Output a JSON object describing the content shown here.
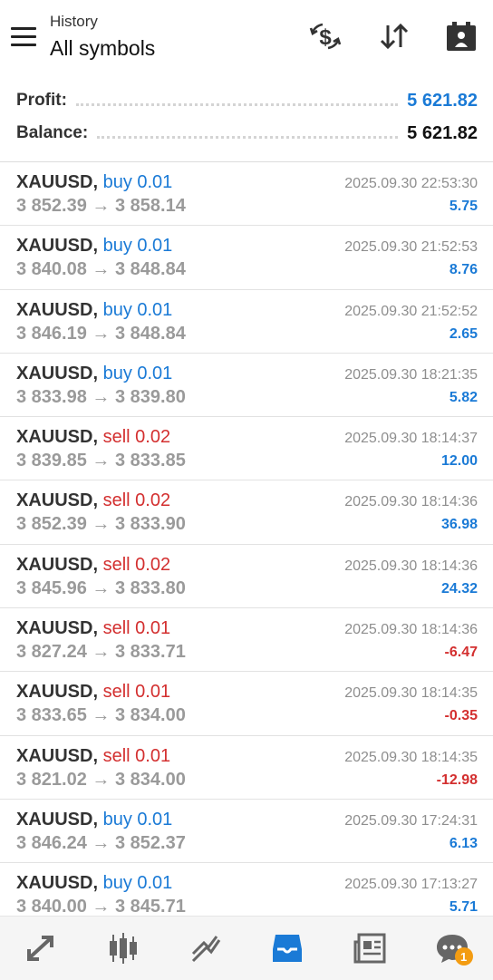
{
  "header": {
    "subtitle": "History",
    "title": "All symbols",
    "icons": [
      "menu-icon",
      "deposit-withdraw-icon",
      "sort-icon",
      "calendar-icon"
    ]
  },
  "summary": {
    "profit_label": "Profit:",
    "profit_value": "5 621.82",
    "balance_label": "Balance:",
    "balance_value": "5 621.82"
  },
  "trades": [
    {
      "symbol": "XAUUSD,",
      "side": "buy 0.01",
      "prices": "3 852.39 → 3 858.14",
      "time": "2025.09.30 22:53:30",
      "profit": "5.75"
    },
    {
      "symbol": "XAUUSD,",
      "side": "buy 0.01",
      "prices": "3 840.08 → 3 848.84",
      "time": "2025.09.30 21:52:53",
      "profit": "8.76"
    },
    {
      "symbol": "XAUUSD,",
      "side": "buy 0.01",
      "prices": "3 846.19 → 3 848.84",
      "time": "2025.09.30 21:52:52",
      "profit": "2.65"
    },
    {
      "symbol": "XAUUSD,",
      "side": "buy 0.01",
      "prices": "3 833.98 → 3 839.80",
      "time": "2025.09.30 18:21:35",
      "profit": "5.82"
    },
    {
      "symbol": "XAUUSD,",
      "side": "sell 0.02",
      "prices": "3 839.85 → 3 833.85",
      "time": "2025.09.30 18:14:37",
      "profit": "12.00"
    },
    {
      "symbol": "XAUUSD,",
      "side": "sell 0.02",
      "prices": "3 852.39 → 3 833.90",
      "time": "2025.09.30 18:14:36",
      "profit": "36.98"
    },
    {
      "symbol": "XAUUSD,",
      "side": "sell 0.02",
      "prices": "3 845.96 → 3 833.80",
      "time": "2025.09.30 18:14:36",
      "profit": "24.32"
    },
    {
      "symbol": "XAUUSD,",
      "side": "sell 0.01",
      "prices": "3 827.24 → 3 833.71",
      "time": "2025.09.30 18:14:36",
      "profit": "-6.47"
    },
    {
      "symbol": "XAUUSD,",
      "side": "sell 0.01",
      "prices": "3 833.65 → 3 834.00",
      "time": "2025.09.30 18:14:35",
      "profit": "-0.35"
    },
    {
      "symbol": "XAUUSD,",
      "side": "sell 0.01",
      "prices": "3 821.02 → 3 834.00",
      "time": "2025.09.30 18:14:35",
      "profit": "-12.98"
    },
    {
      "symbol": "XAUUSD,",
      "side": "buy 0.01",
      "prices": "3 846.24 → 3 852.37",
      "time": "2025.09.30 17:24:31",
      "profit": "6.13"
    },
    {
      "symbol": "XAUUSD,",
      "side": "buy 0.01",
      "prices": "3 840.00 → 3 845.71",
      "time": "2025.09.30 17:13:27",
      "profit": "5.71"
    }
  ],
  "bottom_nav": {
    "items": [
      "quotes-icon",
      "chart-icon",
      "trade-icon",
      "history-icon",
      "news-icon",
      "messages-icon"
    ],
    "active": "history-icon",
    "messages_badge": "1"
  },
  "colors": {
    "buy": "#1a7ad6",
    "sell": "#d32f2f",
    "profit_positive": "#1a7ad6",
    "profit_negative": "#d32f2f",
    "active_nav": "#1a7ad6",
    "badge": "#f39c12"
  }
}
